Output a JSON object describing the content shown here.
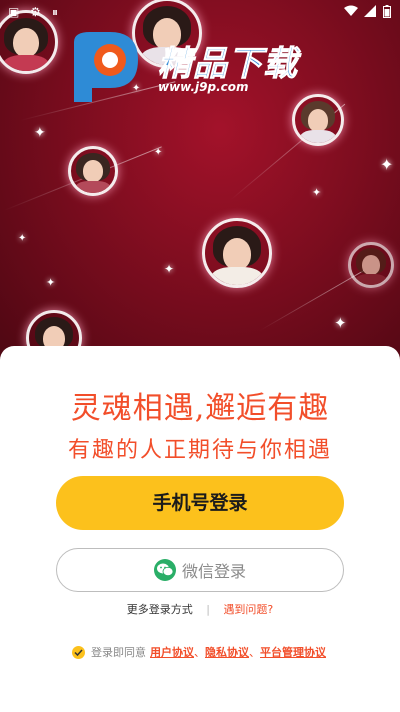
{
  "status_bar": {
    "left_icons": [
      "gallery-icon",
      "settings-icon",
      "pause-icon"
    ],
    "right_icons": [
      "wifi-icon",
      "signal-icon",
      "battery-icon"
    ]
  },
  "logo": {
    "title": "精品下载",
    "url": "www.j9p.com"
  },
  "headline": {
    "line1": "灵魂相遇,邂逅有趣",
    "line2": "有趣的人正期待与你相遇"
  },
  "buttons": {
    "phone_login": "手机号登录",
    "wechat_login": "微信登录"
  },
  "more": {
    "more_login": "更多登录方式",
    "separator": "|",
    "problem": "遇到问题?"
  },
  "agreement": {
    "prefix": "登录即同意",
    "user": "用户协议",
    "sep1": "、",
    "privacy": "隐私协议",
    "sep2": "、",
    "platform": "平台管理协议"
  },
  "colors": {
    "accent_yellow": "#fcc11c",
    "accent_red": "#f24e2a",
    "hero_dark": "#7d0d1f",
    "wechat_green": "#2aae67"
  }
}
